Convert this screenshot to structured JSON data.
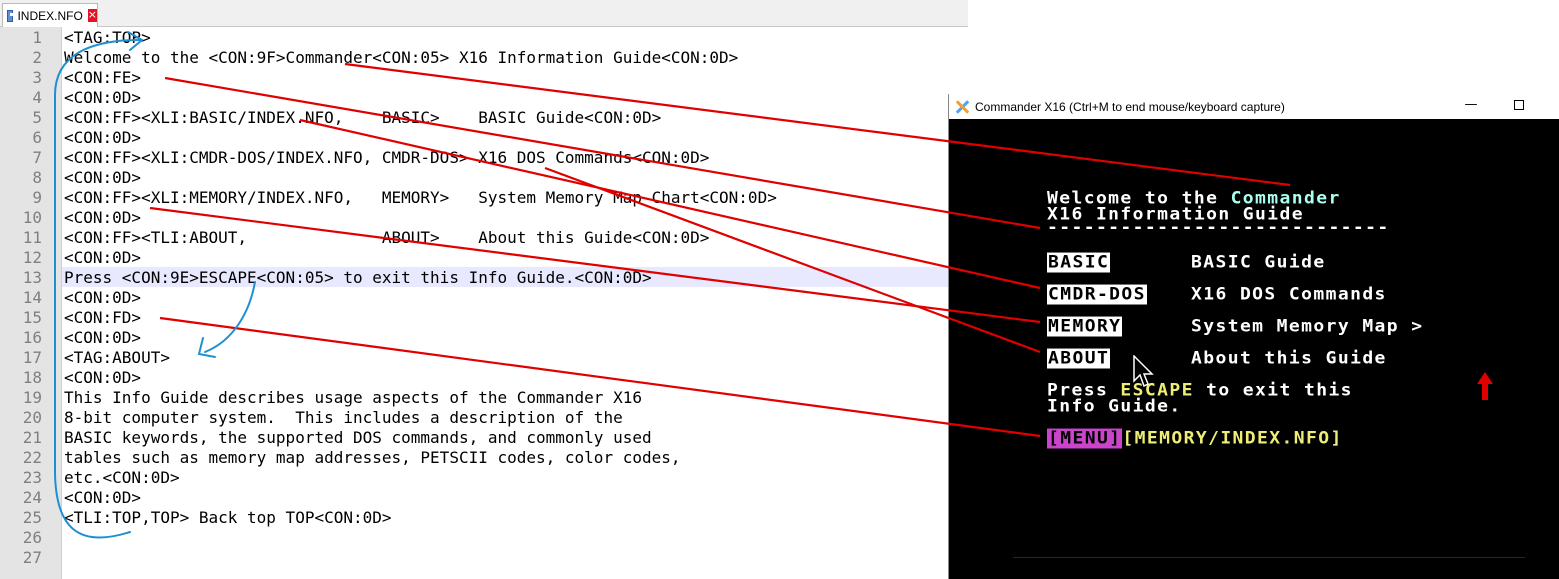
{
  "editor": {
    "tab": {
      "label": "INDEX.NFO",
      "close": "×"
    },
    "lines": [
      "<TAG:TOP>",
      "Welcome to the <CON:9F>Commander<CON:05> X16 Information Guide<CON:0D>",
      "<CON:FE>",
      "<CON:0D>",
      "<CON:FF><XLI:BASIC/INDEX.NFO,    BASIC>    BASIC Guide<CON:0D>",
      "<CON:0D>",
      "<CON:FF><XLI:CMDR-DOS/INDEX.NFO, CMDR-DOS> X16 DOS Commands<CON:0D>",
      "<CON:0D>",
      "<CON:FF><XLI:MEMORY/INDEX.NFO,   MEMORY>   System Memory Map Chart<CON:0D>",
      "<CON:0D>",
      "<CON:FF><TLI:ABOUT,              ABOUT>    About this Guide<CON:0D>",
      "<CON:0D>",
      "Press <CON:9E>ESCAPE<CON:05> to exit this Info Guide.<CON:0D>",
      "<CON:0D>",
      "<CON:FD>",
      "<CON:0D>",
      "<TAG:ABOUT>",
      "<CON:0D>",
      "This Info Guide describes usage aspects of the Commander X16",
      "8-bit computer system.  This includes a description of the",
      "BASIC keywords, the supported DOS commands, and commonly used",
      "tables such as memory map addresses, PETSCII codes, color codes,",
      "etc.<CON:0D>",
      "<CON:0D>",
      "<TLI:TOP,TOP> Back top TOP<CON:0D>",
      "",
      ""
    ]
  },
  "emulator": {
    "title": "Commander X16 (Ctrl+M to end mouse/keyboard capture)",
    "minimize": "—",
    "screen": {
      "welcome_prefix": "Welcome to the ",
      "welcome_brand": "Commander",
      "welcome_line2": "X16 Information Guide",
      "separator": "----------------------------",
      "menu": [
        {
          "tag": "BASIC",
          "label": "BASIC Guide"
        },
        {
          "tag": "CMDR-DOS",
          "label": "X16 DOS Commands"
        },
        {
          "tag": "MEMORY",
          "label": "System Memory Map >"
        },
        {
          "tag": "ABOUT",
          "label": "About this Guide"
        }
      ],
      "press_prefix": "Press ",
      "press_key": "ESCAPE",
      "press_suffix": " to exit this",
      "press_line2": "Info Guide.",
      "status_tag": "[MENU]",
      "status_path": "[MEMORY/INDEX.NFO]"
    }
  },
  "colors": {
    "annotation_red": "#e00000",
    "annotation_blue": "#1e90d0",
    "brand_cyan": "#aaffee",
    "key_yellow": "#eeee77",
    "status_magenta": "#cc44cc"
  }
}
